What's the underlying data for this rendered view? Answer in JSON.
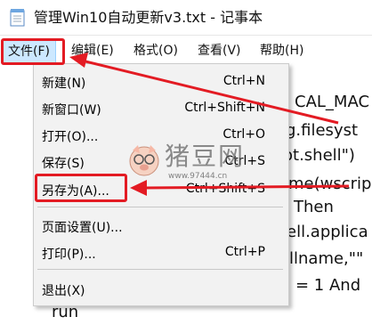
{
  "window": {
    "title": "管理Win10自动更新v3.txt - 记事本",
    "icon": "notepad-icon"
  },
  "menubar": {
    "file": "文件(F)",
    "edit": "编辑(E)",
    "format": "格式(O)",
    "view": "查看(V)",
    "help": "帮助(H)"
  },
  "file_menu": {
    "items": [
      {
        "label": "新建(N)",
        "shortcut": "Ctrl+N"
      },
      {
        "label": "新窗口(W)",
        "shortcut": "Ctrl+Shift+N"
      },
      {
        "label": "打开(O)...",
        "shortcut": "Ctrl+O"
      },
      {
        "label": "保存(S)",
        "shortcut": "Ctrl+S"
      },
      {
        "label": "另存为(A)...",
        "shortcut": "Ctrl+Shift+S"
      },
      {
        "label": "页面设置(U)...",
        "shortcut": ""
      },
      {
        "label": "打印(P)...",
        "shortcut": "Ctrl+P"
      },
      {
        "label": "退出(X)",
        "shortcut": ""
      }
    ]
  },
  "editor": {
    "lines": [
      "CAL_MAC",
      "g.filesyst",
      "ot.shell\")",
      "me(wscrip",
      "Then",
      "ell.applica",
      "llname,\"\"",
      "= 1 And",
      "run"
    ]
  },
  "watermark": {
    "name": "猪豆网",
    "url": "www.97444.cn"
  },
  "colors": {
    "highlight": "#e31b23",
    "menu_active": "#cce8ff"
  }
}
